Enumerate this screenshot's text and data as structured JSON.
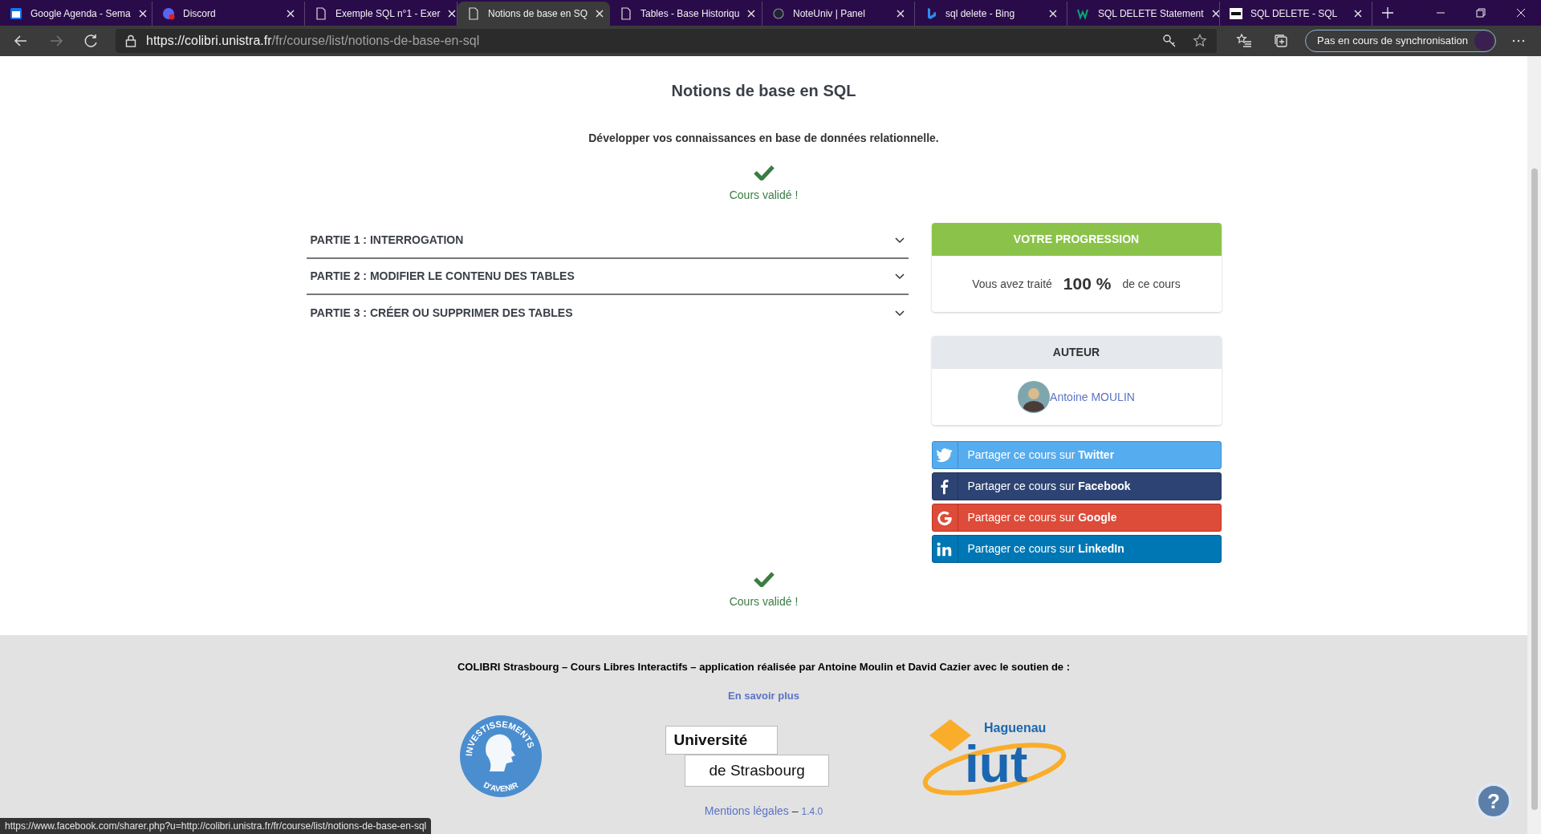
{
  "browser": {
    "tabs": [
      {
        "title": "Google Agenda - Sema",
        "kind": "calendar",
        "selected": false
      },
      {
        "title": "Discord",
        "kind": "discord",
        "selected": false
      },
      {
        "title": "Exemple SQL n°1 - Exer",
        "kind": "page",
        "selected": false
      },
      {
        "title": "Notions de base en SQ",
        "kind": "page",
        "selected": true
      },
      {
        "title": "Tables - Base Historiqu",
        "kind": "page",
        "selected": false
      },
      {
        "title": "NoteUniv | Panel",
        "kind": "panel",
        "selected": false
      },
      {
        "title": "sql delete - Bing",
        "kind": "bing",
        "selected": false
      },
      {
        "title": "SQL DELETE Statement",
        "kind": "w3",
        "selected": false
      },
      {
        "title": "SQL DELETE - SQL",
        "kind": "sql",
        "selected": false
      }
    ],
    "address": {
      "host": "https://colibri.unistra.fr",
      "path": "/fr/course/list/notions-de-base-en-sql"
    },
    "sync_button": "Pas en cours de synchronisation"
  },
  "page": {
    "title": "Notions de base en SQL",
    "subtitle": "Développer vos connaissances en base de données relationnelle.",
    "status_top": "Cours validé !",
    "parts": [
      {
        "label": "PARTIE 1 : INTERROGATION",
        "expanded": false
      },
      {
        "label": "PARTIE 2 : MODIFIER LE CONTENU DES TABLES",
        "expanded": false
      },
      {
        "label": "PARTIE 3 : CRÉER OU SUPPRIMER DES TABLES",
        "expanded": false
      }
    ],
    "progress": {
      "header": "VOTRE PROGRESSION",
      "prefix": "Vous avez traité",
      "value": "100 %",
      "suffix": "de ce cours"
    },
    "author": {
      "header": "AUTEUR",
      "name": "Antoine MOULIN"
    },
    "share": [
      {
        "kind": "twitter",
        "text": "Partager ce cours sur **Twitter**"
      },
      {
        "kind": "facebook",
        "text": "Partager ce cours sur **Facebook**"
      },
      {
        "kind": "google",
        "text": "Partager ce cours sur **Google**"
      },
      {
        "kind": "linkedin",
        "text": "Partager ce cours sur **LinkedIn**"
      }
    ],
    "status_bottom": "Cours validé !"
  },
  "footer": {
    "credits": "COLIBRI Strasbourg – Cours Libres Interactifs – application réalisée par Antoine Moulin et David Cazier avec le soutien de :",
    "more_link": "En savoir plus",
    "investissements_logo": {
      "top": "INVESTISSEMENTS",
      "bottom": "D'AVENIR"
    },
    "unistra_logo": {
      "line1": "Université",
      "line2": "de Strasbourg"
    },
    "iut_logo": {
      "city": "Haguenau",
      "name": "iut"
    },
    "legal_link": "Mentions légales",
    "separator": "–",
    "version": "1.4.0"
  },
  "help_button": "?",
  "status_url": "https://www.facebook.com/sharer.php?u=http://colibri.unistra.fr/fr/course/list/notions-de-base-en-sql"
}
